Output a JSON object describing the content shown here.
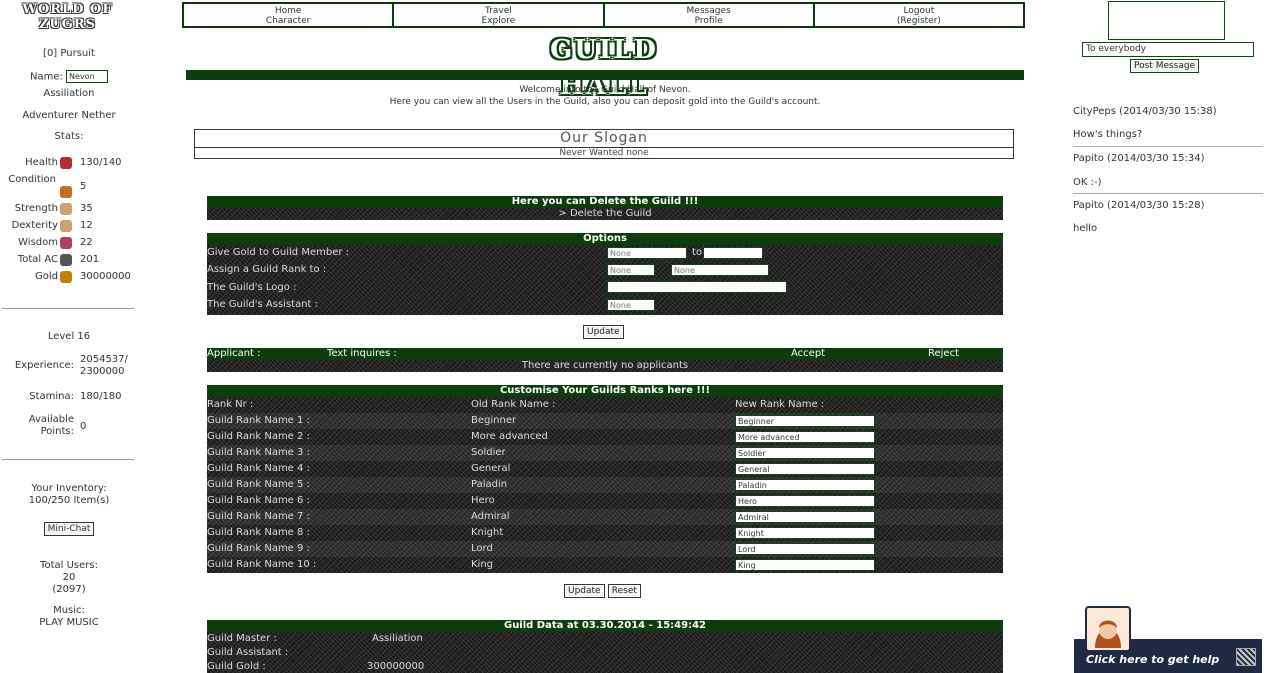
{
  "left": {
    "logo_line1": "WORLD OF",
    "logo_line2": "ZUGRS",
    "user_id": "[0] Pursuit",
    "name_label": "Name:",
    "name_value": "Nevon",
    "subtitle": "Assiliation",
    "adventurer_label": "Adventurer",
    "adventurer_value": "Nether",
    "stats_label": "Stats:",
    "stats": [
      {
        "label": "Health",
        "icon": "heart-icon",
        "value": "130/140",
        "color": "#b03030"
      },
      {
        "label": "Condition",
        "icon": "rooster-icon",
        "value": "5",
        "color": "#c07020"
      },
      {
        "label": "Strength",
        "icon": "fist-icon",
        "value": "35",
        "color": "#d0a070"
      },
      {
        "label": "Dexterity",
        "icon": "hand-icon",
        "value": "12",
        "color": "#d0a070"
      },
      {
        "label": "Wisdom",
        "icon": "brain-icon",
        "value": "22",
        "color": "#b04060"
      },
      {
        "label": "Total AC",
        "icon": "swords-icon",
        "value": "201",
        "color": "#555555"
      },
      {
        "label": "Gold",
        "icon": "gold-icon",
        "value": "30000000",
        "color": "#c08010"
      }
    ],
    "level_label": "Level",
    "level_value": "16",
    "experience_label": "Experience:",
    "experience_value": "2054537/ 2300000",
    "stamina_label": "Stamina:",
    "stamina_value": "180/180",
    "points_label": "Available Points:",
    "points_value": "0",
    "inventory_label": "Your Inventory:",
    "inventory_value": "100/250 Item(s)",
    "minichat_button": "Mini-Chat",
    "total_users_label": "Total Users:",
    "total_users_value": "20",
    "total_users_extra": "(2097)",
    "music_label": "Music:",
    "music_value": "PLAY MUSIC"
  },
  "nav": [
    {
      "line1": "Home",
      "line2": "Character"
    },
    {
      "line1": "Travel",
      "line2": "Explore"
    },
    {
      "line1": "Messages",
      "line2": "Profile"
    },
    {
      "line1": "Logout",
      "line2": "(Register)"
    }
  ],
  "page_title": "GUILD HALL",
  "welcome_line1": "Welcome into the Guild Hall of Nevon.",
  "welcome_line2": "Here you can view all the Users in the Guild, also you can deposit gold into the Guild's account.",
  "slogan": {
    "title": "Our Slogan",
    "text": "Never Wanted none"
  },
  "delete": {
    "header": "Here you can Delete the Guild !!!",
    "link": "> Delete the Guild"
  },
  "options": {
    "header": "Options",
    "rows": [
      {
        "label": "Give Gold to Guild Member :",
        "in1": "None",
        "mid": "to",
        "in2": ""
      },
      {
        "label": "Assign a Guild Rank to :",
        "in1": "None",
        "mid": "",
        "in2": "None"
      },
      {
        "label": "The Guild's Logo :",
        "in1": "",
        "mid": "",
        "in2": ""
      },
      {
        "label": "The Guild's Assistant :",
        "in1": "None",
        "mid": "",
        "in2": ""
      }
    ],
    "update_button": "Update"
  },
  "applicants": {
    "cols": [
      "Applicant :",
      "Text inquires :",
      "Accept",
      "Reject"
    ],
    "empty": "There are currently no applicants"
  },
  "ranks": {
    "header": "Customise Your Guilds Ranks here !!!",
    "cols": [
      "Rank Nr :",
      "Old Rank Name :",
      "New Rank Name :"
    ],
    "rows": [
      {
        "nr": "Guild Rank Name 1 :",
        "old": "Beginner",
        "new": "Beginner"
      },
      {
        "nr": "Guild Rank Name 2 :",
        "old": "More advanced",
        "new": "More advanced"
      },
      {
        "nr": "Guild Rank Name 3 :",
        "old": "Soldier",
        "new": "Soldier"
      },
      {
        "nr": "Guild Rank Name 4 :",
        "old": "General",
        "new": "General"
      },
      {
        "nr": "Guild Rank Name 5 :",
        "old": "Paladin",
        "new": "Paladin"
      },
      {
        "nr": "Guild Rank Name 6 :",
        "old": "Hero",
        "new": "Hero"
      },
      {
        "nr": "Guild Rank Name 7 :",
        "old": "Admiral",
        "new": "Admiral"
      },
      {
        "nr": "Guild Rank Name 8 :",
        "old": "Knight",
        "new": "Knight"
      },
      {
        "nr": "Guild Rank Name 9 :",
        "old": "Lord",
        "new": "Lord"
      },
      {
        "nr": "Guild Rank Name 10 :",
        "old": "King",
        "new": "King"
      }
    ],
    "update_button": "Update",
    "reset_button": "Reset"
  },
  "guild_data": {
    "header": "Guild Data at 03.30.2014 - 15:49:42",
    "rows": [
      {
        "label": "Guild Master :",
        "value": "Assiliation"
      },
      {
        "label": "Guild Assistant :",
        "value": ""
      },
      {
        "label": "Guild Gold :",
        "value": "300000000"
      }
    ]
  },
  "right": {
    "recipient": "To everybody",
    "post_button": "Post Message",
    "posts": [
      {
        "text": "CityPeps (2014/03/30 15:38)"
      },
      {
        "text": "How's things?"
      },
      {
        "text": "Papito (2014/03/30 15:34)"
      },
      {
        "text": "OK :-)"
      },
      {
        "text": "Papito (2014/03/30 15:28)"
      },
      {
        "text": "hello"
      }
    ],
    "help_text": "Click here to get help"
  }
}
